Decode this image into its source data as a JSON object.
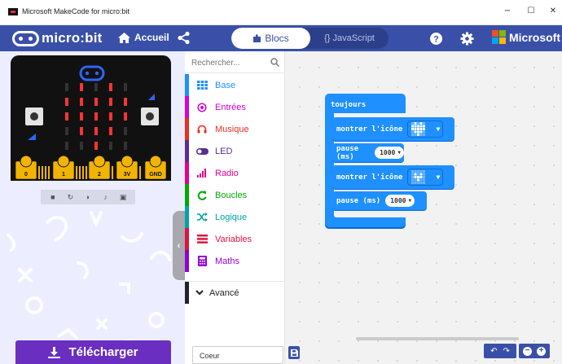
{
  "window": {
    "title": "Microsoft MakeCode for micro:bit",
    "minimize": "−",
    "maximize": "☐",
    "close": "✕"
  },
  "header": {
    "logo": "micro:bit",
    "home_label": "Accueil",
    "tabs": [
      {
        "label": "Blocs",
        "active": true
      },
      {
        "label": "{} JavaScript",
        "active": false
      }
    ],
    "brand": "Microsoft",
    "accent": "#3a50a8"
  },
  "simulator": {
    "pins": [
      "0",
      "1",
      "2",
      "3V",
      "GND"
    ],
    "controls": [
      "stop-icon",
      "restart-icon",
      "slow-motion-icon",
      "audio-icon",
      "screenshot-icon"
    ]
  },
  "toolbox": {
    "search_placeholder": "Rechercher...",
    "categories": [
      {
        "label": "Base",
        "color": "#1e90ff",
        "icon": "grid-icon"
      },
      {
        "label": "Entrées",
        "color": "#d400d4",
        "icon": "target-icon"
      },
      {
        "label": "Musique",
        "color": "#e63022",
        "icon": "headphones-icon"
      },
      {
        "label": "LED",
        "color": "#5c2d91",
        "icon": "toggle-icon"
      },
      {
        "label": "Radio",
        "color": "#e3008c",
        "icon": "signal-icon"
      },
      {
        "label": "Boucles",
        "color": "#00aa00",
        "icon": "refresh-icon"
      },
      {
        "label": "Logique",
        "color": "#00a4a6",
        "icon": "shuffle-icon"
      },
      {
        "label": "Variables",
        "color": "#dc143c",
        "icon": "lines-icon"
      },
      {
        "label": "Maths",
        "color": "#9400d3",
        "icon": "calculator-icon"
      }
    ],
    "advanced_label": "Avancé"
  },
  "workspace": {
    "forever_label": "toujours",
    "show_icon_label": "montrer l'icône",
    "pause_label": "pause (ms)",
    "pause_value": "1000",
    "block_color": "#1e90ff"
  },
  "footer": {
    "download_label": "Télécharger",
    "project_name": "Coeur"
  }
}
